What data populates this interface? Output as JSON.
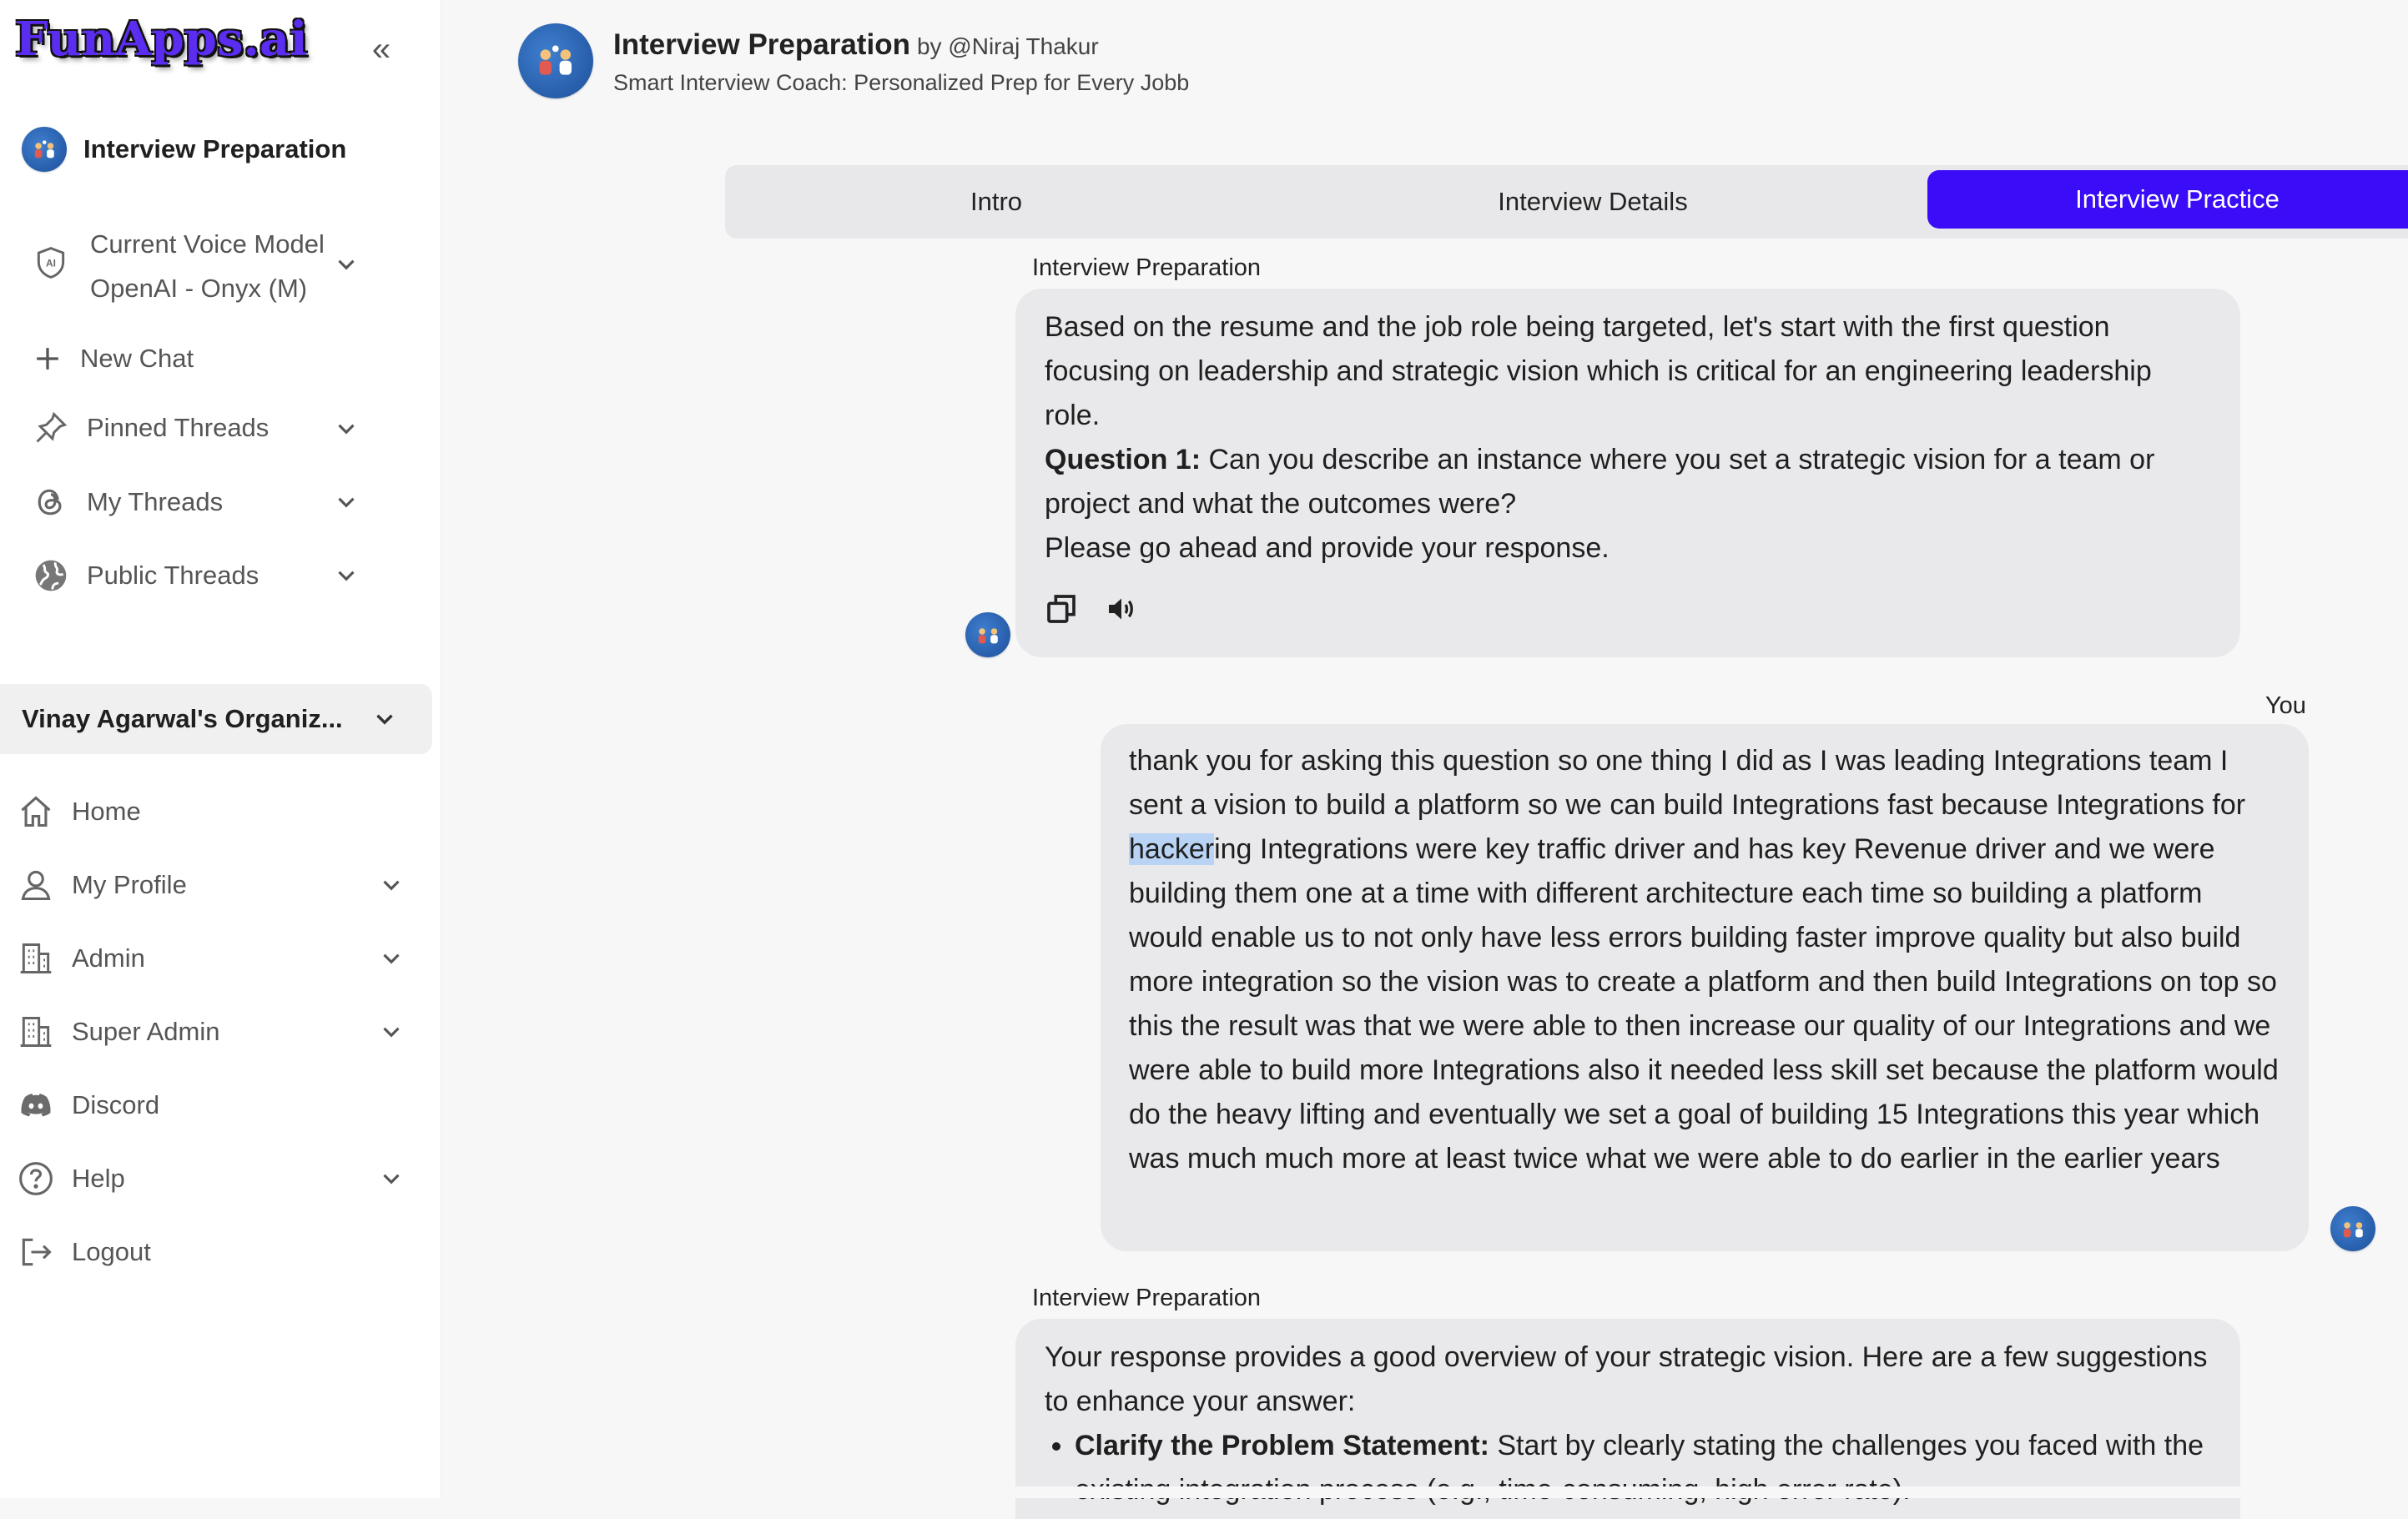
{
  "brand": {
    "logo_text": "FunApps.ai"
  },
  "sidebar": {
    "collapse_label": "«",
    "app_title": "Interview Preparation",
    "voice_model": {
      "label": "Current Voice Model",
      "value": "OpenAI - Onyx (M)"
    },
    "new_chat": "New Chat",
    "pinned_threads": "Pinned Threads",
    "my_threads": "My Threads",
    "public_threads": "Public Threads",
    "org_name": "Vinay Agarwal's Organiz...",
    "nav": {
      "home": "Home",
      "my_profile": "My Profile",
      "admin": "Admin",
      "super_admin": "Super Admin",
      "discord": "Discord",
      "help": "Help",
      "logout": "Logout"
    }
  },
  "header": {
    "title": "Interview Preparation",
    "by": "by @Niraj Thakur",
    "subtitle": "Smart Interview Coach: Personalized Prep for Every Jobb"
  },
  "tabs": [
    {
      "label": "Intro",
      "active": false
    },
    {
      "label": "Interview Details",
      "active": false
    },
    {
      "label": "Interview Practice",
      "active": true
    }
  ],
  "messages": {
    "m1": {
      "sender": "Interview Preparation",
      "para1": "Based on the resume and the job role being targeted, let's start with the first question focusing on leadership and strategic vision which is critical for an engineering leadership role.",
      "q_label": "Question 1:",
      "q_text": " Can you describe an instance where you set a strategic vision for a team or project and what the outcomes were?",
      "para3": "Please go ahead and provide your response."
    },
    "m2": {
      "sender": "You",
      "text_before": "thank you for asking this question so one thing I did as I was leading Integrations team I sent a vision to build a platform so we can build Integrations fast because Integrations for ",
      "text_highlight": "hacker",
      "text_after": "ing Integrations were key traffic driver and has key Revenue driver and we were building them one at a time with different architecture each time so building a platform would enable us to not only have less errors building faster improve quality but also build more integration so the vision was to create a platform and then build Integrations on top so this the result was that we were able to then increase our quality of our Integrations and we were able to build more Integrations also it needed less skill set because the platform would do the heavy lifting and eventually we set a goal of building 15 Integrations this year which was much much more at least twice what we were able to do earlier in the earlier years"
    },
    "m3": {
      "sender": "Interview Preparation",
      "intro": "Your response provides a good overview of your strategic vision. Here are a few suggestions to enhance your answer:",
      "bullet1_label": "Clarify the Problem Statement:",
      "bullet1_text": " Start by clearly stating the challenges you faced with the existing integration process (e.g., time-consuming, high error rate)."
    }
  },
  "colors": {
    "accent": "#3a0cf7",
    "logo": "#5b2df0",
    "bubble": "#e9e9eb",
    "highlight": "#b9d3f5"
  }
}
